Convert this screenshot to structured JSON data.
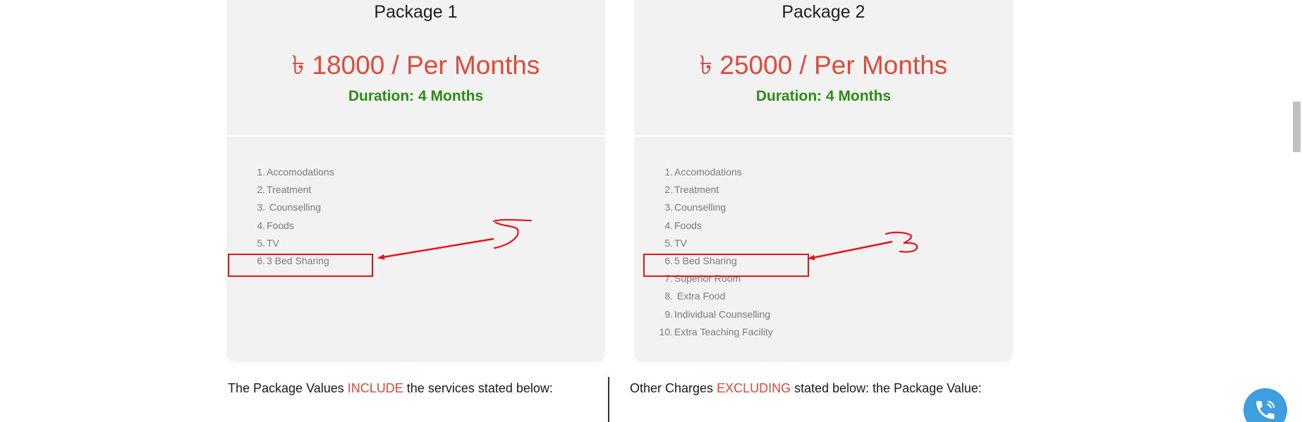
{
  "packages": [
    {
      "title": "Package 1",
      "price": "৳ 18000 / Per Months",
      "duration": "Duration: 4 Months",
      "features": [
        {
          "num": "1.",
          "text": "Accomodations"
        },
        {
          "num": "2.",
          "text": "Treatment"
        },
        {
          "num": "3.",
          "text": " Counselling"
        },
        {
          "num": "4.",
          "text": "Foods"
        },
        {
          "num": "5.",
          "text": "TV"
        },
        {
          "num": "6.",
          "text": "3 Bed Sharing"
        }
      ]
    },
    {
      "title": "Package 2",
      "price": "৳ 25000 / Per Months",
      "duration": "Duration: 4 Months",
      "features": [
        {
          "num": "1.",
          "text": "Accomodations"
        },
        {
          "num": "2.",
          "text": "Treatment"
        },
        {
          "num": "3.",
          "text": "Counselling"
        },
        {
          "num": "4.",
          "text": "Foods"
        },
        {
          "num": "5.",
          "text": "TV"
        },
        {
          "num": "6.",
          "text": "5 Bed Sharing"
        },
        {
          "num": "7.",
          "text": "Superior Room"
        },
        {
          "num": "8.",
          "text": " Extra Food"
        },
        {
          "num": "9.",
          "text": "Individual Counselling"
        },
        {
          "num": "10.",
          "text": "Extra Teaching Facility"
        }
      ]
    }
  ],
  "bottom": {
    "left_prefix": "The Package Values ",
    "left_highlight": "INCLUDE",
    "left_suffix": " the services stated below:",
    "right_prefix": "Other Charges ",
    "right_highlight": "EXCLUDING",
    "right_suffix": " stated below: the Package Value:"
  },
  "colors": {
    "price": "#e04a3a",
    "duration": "#2e8a17",
    "annotation": "#e8141a",
    "card_bg": "#f2f2f2",
    "call_button": "#3f9ee0"
  },
  "icons": {
    "call_button": "phone-icon"
  }
}
